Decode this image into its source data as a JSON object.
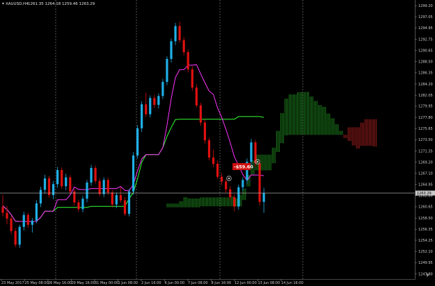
{
  "title": {
    "symbol": "XAUUSD,H4",
    "ohlc": "1261.35 1264.18 1259.46 1263.29"
  },
  "price_axis": {
    "ticks": [
      "1299.20",
      "1297.05",
      "1294.95",
      "1292.75",
      "1290.65",
      "1288.50",
      "1286.35",
      "1284.20",
      "1282.05",
      "1279.95",
      "1277.80",
      "1275.65",
      "1273.50",
      "1271.35",
      "1269.20",
      "1267.10",
      "1264.95",
      "1262.80",
      "1260.65",
      "1258.50",
      "1256.35",
      "1254.25",
      "1252.10",
      "1249.95",
      "1247.80"
    ],
    "current_price": "1263.29"
  },
  "time_axis": {
    "ticks": [
      "23 May 2017",
      "25 May 08:00",
      "26 May 16:00",
      "29 May 16:00",
      "31 May 00:00",
      "1 Jun 08:00",
      "2 Jun 16:00",
      "6 Jun 00:00",
      "7 Jun 08:00",
      "8 Jun 16:00",
      "12 Jun 00:00",
      "13 Jun 08:00",
      "14 Jun 16:00"
    ]
  },
  "trade": {
    "pl_label": "-$59.60"
  },
  "colors": {
    "background": "#000000",
    "bull_candle": "#1fb0e8",
    "bear_candle": "#e01010",
    "tenkan": "#ff33ff",
    "kijun": "#33ff33",
    "cloud_bull": "#229922",
    "cloud_bear": "#bb2222",
    "price_line": "#c8c8c8",
    "pl_box": "#d01010"
  },
  "chart_data": {
    "type": "candlestick",
    "symbol": "XAUUSD",
    "timeframe": "H4",
    "ylim": [
      1246.8,
      1300.3
    ],
    "grid": false,
    "candles": [
      [
        1260.6,
        1262.9,
        1258.8,
        1259.5
      ],
      [
        1259.5,
        1260.8,
        1257.3,
        1258.4
      ],
      [
        1258.4,
        1258.9,
        1255.4,
        1256.0
      ],
      [
        1256.0,
        1256.5,
        1252.9,
        1253.4
      ],
      [
        1253.4,
        1257.2,
        1252.8,
        1256.8
      ],
      [
        1256.8,
        1259.7,
        1256.1,
        1259.1
      ],
      [
        1259.1,
        1259.5,
        1256.6,
        1257.2
      ],
      [
        1257.2,
        1258.5,
        1255.7,
        1258.0
      ],
      [
        1258.0,
        1261.9,
        1257.5,
        1261.3
      ],
      [
        1261.3,
        1264.5,
        1260.6,
        1263.9
      ],
      [
        1263.9,
        1266.8,
        1263.2,
        1266.1
      ],
      [
        1266.1,
        1266.6,
        1262.4,
        1262.9
      ],
      [
        1262.9,
        1265.6,
        1262.1,
        1265.0
      ],
      [
        1265.0,
        1268.3,
        1264.3,
        1267.7
      ],
      [
        1267.7,
        1268.2,
        1264.1,
        1264.6
      ],
      [
        1264.6,
        1267.0,
        1263.8,
        1266.3
      ],
      [
        1266.3,
        1266.7,
        1263.1,
        1263.6
      ],
      [
        1263.6,
        1264.1,
        1260.9,
        1261.5
      ],
      [
        1261.5,
        1262.0,
        1259.7,
        1260.2
      ],
      [
        1260.2,
        1262.7,
        1259.6,
        1262.2
      ],
      [
        1262.2,
        1265.8,
        1261.5,
        1265.3
      ],
      [
        1265.3,
        1268.7,
        1264.7,
        1268.1
      ],
      [
        1268.1,
        1268.6,
        1265.1,
        1265.6
      ],
      [
        1265.6,
        1266.1,
        1262.7,
        1263.1
      ],
      [
        1263.1,
        1266.3,
        1262.5,
        1265.8
      ],
      [
        1265.8,
        1266.2,
        1262.9,
        1263.4
      ],
      [
        1263.4,
        1263.9,
        1260.6,
        1261.1
      ],
      [
        1261.1,
        1263.4,
        1260.4,
        1262.9
      ],
      [
        1262.9,
        1264.4,
        1261.4,
        1261.9
      ],
      [
        1261.9,
        1262.5,
        1258.9,
        1259.3
      ],
      [
        1259.3,
        1264.1,
        1258.8,
        1263.6
      ],
      [
        1263.6,
        1271.1,
        1263.0,
        1270.5
      ],
      [
        1270.5,
        1276.3,
        1269.9,
        1275.7
      ],
      [
        1275.7,
        1280.9,
        1275.0,
        1280.3
      ],
      [
        1280.3,
        1282.5,
        1277.9,
        1278.4
      ],
      [
        1278.4,
        1282.0,
        1277.8,
        1281.5
      ],
      [
        1281.5,
        1282.1,
        1279.6,
        1280.2
      ],
      [
        1280.2,
        1282.4,
        1279.5,
        1281.9
      ],
      [
        1281.9,
        1285.2,
        1281.3,
        1284.6
      ],
      [
        1284.6,
        1289.5,
        1284.0,
        1289.0
      ],
      [
        1289.0,
        1292.9,
        1288.3,
        1292.4
      ],
      [
        1292.4,
        1295.9,
        1291.7,
        1295.3
      ],
      [
        1295.3,
        1296.1,
        1292.1,
        1292.6
      ],
      [
        1292.6,
        1293.2,
        1289.7,
        1290.3
      ],
      [
        1290.3,
        1290.8,
        1286.4,
        1287.0
      ],
      [
        1287.0,
        1287.6,
        1282.9,
        1283.5
      ],
      [
        1283.5,
        1284.1,
        1279.7,
        1280.1
      ],
      [
        1280.1,
        1280.6,
        1276.2,
        1276.8
      ],
      [
        1276.8,
        1277.4,
        1272.8,
        1273.4
      ],
      [
        1273.4,
        1273.9,
        1269.6,
        1270.1
      ],
      [
        1270.1,
        1271.6,
        1268.3,
        1268.9
      ],
      [
        1268.9,
        1269.5,
        1266.0,
        1266.4
      ],
      [
        1266.4,
        1267.1,
        1264.8,
        1265.5
      ],
      [
        1265.5,
        1265.9,
        1263.4,
        1264.0
      ],
      [
        1264.0,
        1264.6,
        1261.9,
        1262.5
      ],
      [
        1262.5,
        1263.0,
        1259.8,
        1260.7
      ],
      [
        1260.7,
        1264.9,
        1260.1,
        1264.4
      ],
      [
        1264.4,
        1266.3,
        1263.7,
        1265.8
      ],
      [
        1265.8,
        1269.9,
        1265.1,
        1269.3
      ],
      [
        1269.3,
        1273.7,
        1268.6,
        1273.0
      ],
      [
        1273.0,
        1273.5,
        1268.3,
        1269.0
      ],
      [
        1269.0,
        1269.6,
        1260.9,
        1261.6
      ],
      [
        1261.6,
        1264.3,
        1259.5,
        1263.3
      ]
    ],
    "open_position": {
      "type": "sell",
      "profit": -59.6
    }
  }
}
